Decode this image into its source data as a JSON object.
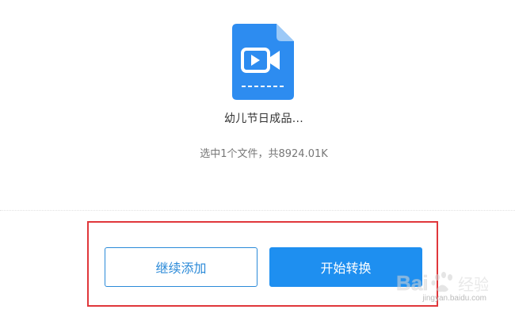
{
  "file": {
    "icon": "video-file-icon",
    "name": "幼儿节日成品...",
    "summary": "选中1个文件，共8924.01K"
  },
  "actions": {
    "add_more_label": "继续添加",
    "start_convert_label": "开始转换"
  },
  "highlight_color": "#e0373b",
  "accent_color": "#1e8ff0",
  "watermark": {
    "text": "jingyan.baidu.com"
  }
}
